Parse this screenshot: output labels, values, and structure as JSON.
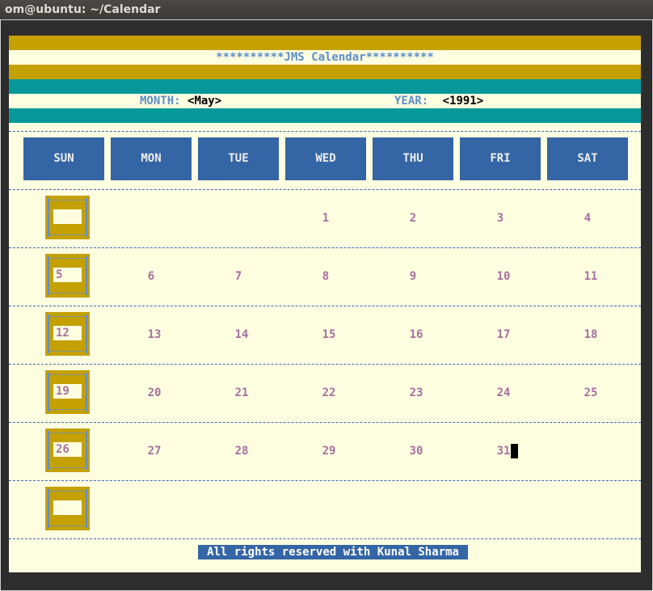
{
  "window": {
    "title": "om@ubuntu: ~/Calendar"
  },
  "calendar": {
    "heading": "**********JMS Calendar**********",
    "month_label": "MONTH:",
    "month_value": "<May>",
    "year_label": "YEAR:",
    "year_value": "<1991>",
    "days": [
      "SUN",
      "MON",
      "TUE",
      "WED",
      "THU",
      "FRI",
      "SAT"
    ],
    "weeks": [
      [
        "",
        "",
        "",
        "1",
        "2",
        "3",
        "4"
      ],
      [
        "5",
        "6",
        "7",
        "8",
        "9",
        "10",
        "11"
      ],
      [
        "12",
        "13",
        "14",
        "15",
        "16",
        "17",
        "18"
      ],
      [
        "19",
        "20",
        "21",
        "22",
        "23",
        "24",
        "25"
      ],
      [
        "26",
        "27",
        "28",
        "29",
        "30",
        "31",
        ""
      ],
      [
        "",
        "",
        "",
        "",
        "",
        "",
        ""
      ]
    ],
    "footer": "All rights reserved with Kunal Sharma"
  },
  "colors": {
    "mustard": "#c4a000",
    "teal": "#06989a",
    "background": "#fdfde0",
    "header_blue": "#3465a4",
    "date_purple": "#a6709f"
  }
}
